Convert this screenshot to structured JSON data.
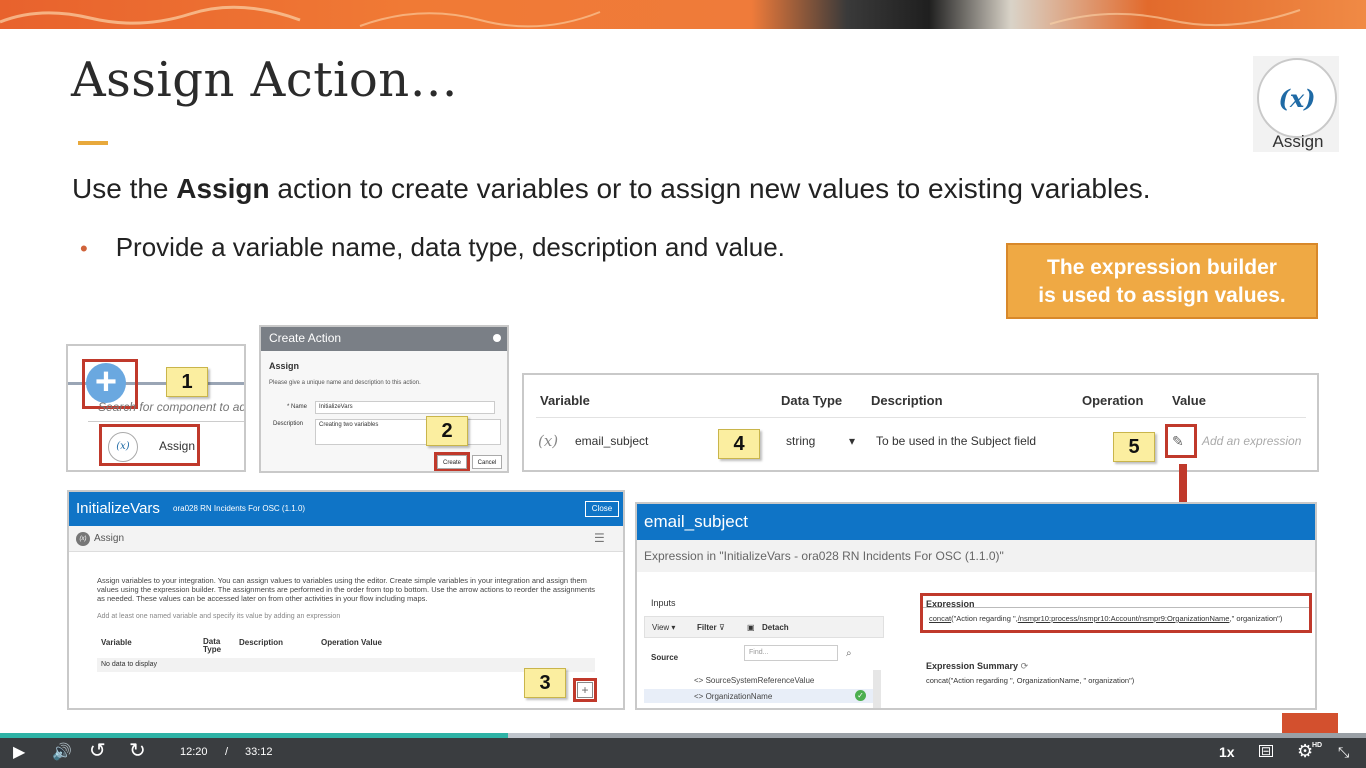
{
  "slide": {
    "title": "Assign Action…",
    "badge_label": "Assign",
    "lead_pre": "Use the ",
    "lead_bold": "Assign",
    "lead_post": " action to create variables or to assign new values to existing variables.",
    "bullet": "Provide a variable name, data type, description and value.",
    "callout_line1": "The expression builder",
    "callout_line2": "is used to assign values."
  },
  "step_labels": [
    "1",
    "2",
    "3",
    "4",
    "5"
  ],
  "panel1": {
    "search_hint": "Search for component to add",
    "assign_label": "Assign"
  },
  "create_action": {
    "header": "Create Action",
    "title": "Assign",
    "subtitle": "Please give a unique name and description to this action.",
    "name_label": "* Name",
    "name_value": "InitializeVars",
    "description_label": "Description",
    "description_value": "Creating two variables",
    "create_button": "Create",
    "cancel_button": "Cancel"
  },
  "variable_table": {
    "headers": [
      "Variable",
      "Data Type",
      "Description",
      "Operation",
      "Value"
    ],
    "row": {
      "icon": "(x)",
      "variable": "email_subject",
      "data_type": "string",
      "dropdown_arrow": "▾",
      "description": "To be used in the Subject field",
      "value_placeholder": "Add an expression"
    }
  },
  "initialize_panel": {
    "title": "InitializeVars",
    "meta": "ora028 RN Incidents For OSC (1.1.0)",
    "close_button": "Close",
    "sub_label": "Assign",
    "description": "Assign variables to your integration. You can assign values to variables using the editor. Create simple variables in your integration and assign them values using the expression builder. The assignments are performed in the order from top to bottom. Use the arrow actions to reorder the assignments as needed. These values can be accessed later on from other activities in your flow including maps.",
    "hint": "Add at least one named variable and specify its value by adding an expression",
    "columns": [
      "Variable",
      "Data Type",
      "Description",
      "Operation Value"
    ],
    "empty_text": "No data to display"
  },
  "expression_panel": {
    "title": "email_subject",
    "subtitle": "Expression in \"InitializeVars - ora028 RN Incidents For OSC (1.1.0)\"",
    "inputs_label": "Inputs",
    "view_label": "View ▾",
    "filter_label": "Filter",
    "detach_label": "Detach",
    "source_label": "Source",
    "find_placeholder": "Find...",
    "tree_items": [
      "<> SourceSystemReferenceValue",
      "<> OrganizationName"
    ],
    "expression_label": "Expression",
    "expression_fn": "concat",
    "expression_mid": "(\"Action regarding \",",
    "expression_path": "/nsmpr10:process/nsmpr10:Account/nsmpr9:OrganizationName",
    "expression_end": ",\" organization\")",
    "summary_label": "Expression Summary",
    "summary_value": "concat(\"Action regarding \", OrganizationName, \" organization\")"
  },
  "player": {
    "current_time": "12:20",
    "separator": "/",
    "duration": "33:12",
    "speed": "1x",
    "progress_fraction": 0.372,
    "buffer_fraction": 0.403,
    "hd_badge": "HD",
    "progress_color": "#2eb3a6"
  },
  "colors": {
    "accent_orange": "#efa944",
    "header_blue": "#0f74c6",
    "highlight_red": "#c0392b",
    "step_yellow": "#fbeea0"
  }
}
